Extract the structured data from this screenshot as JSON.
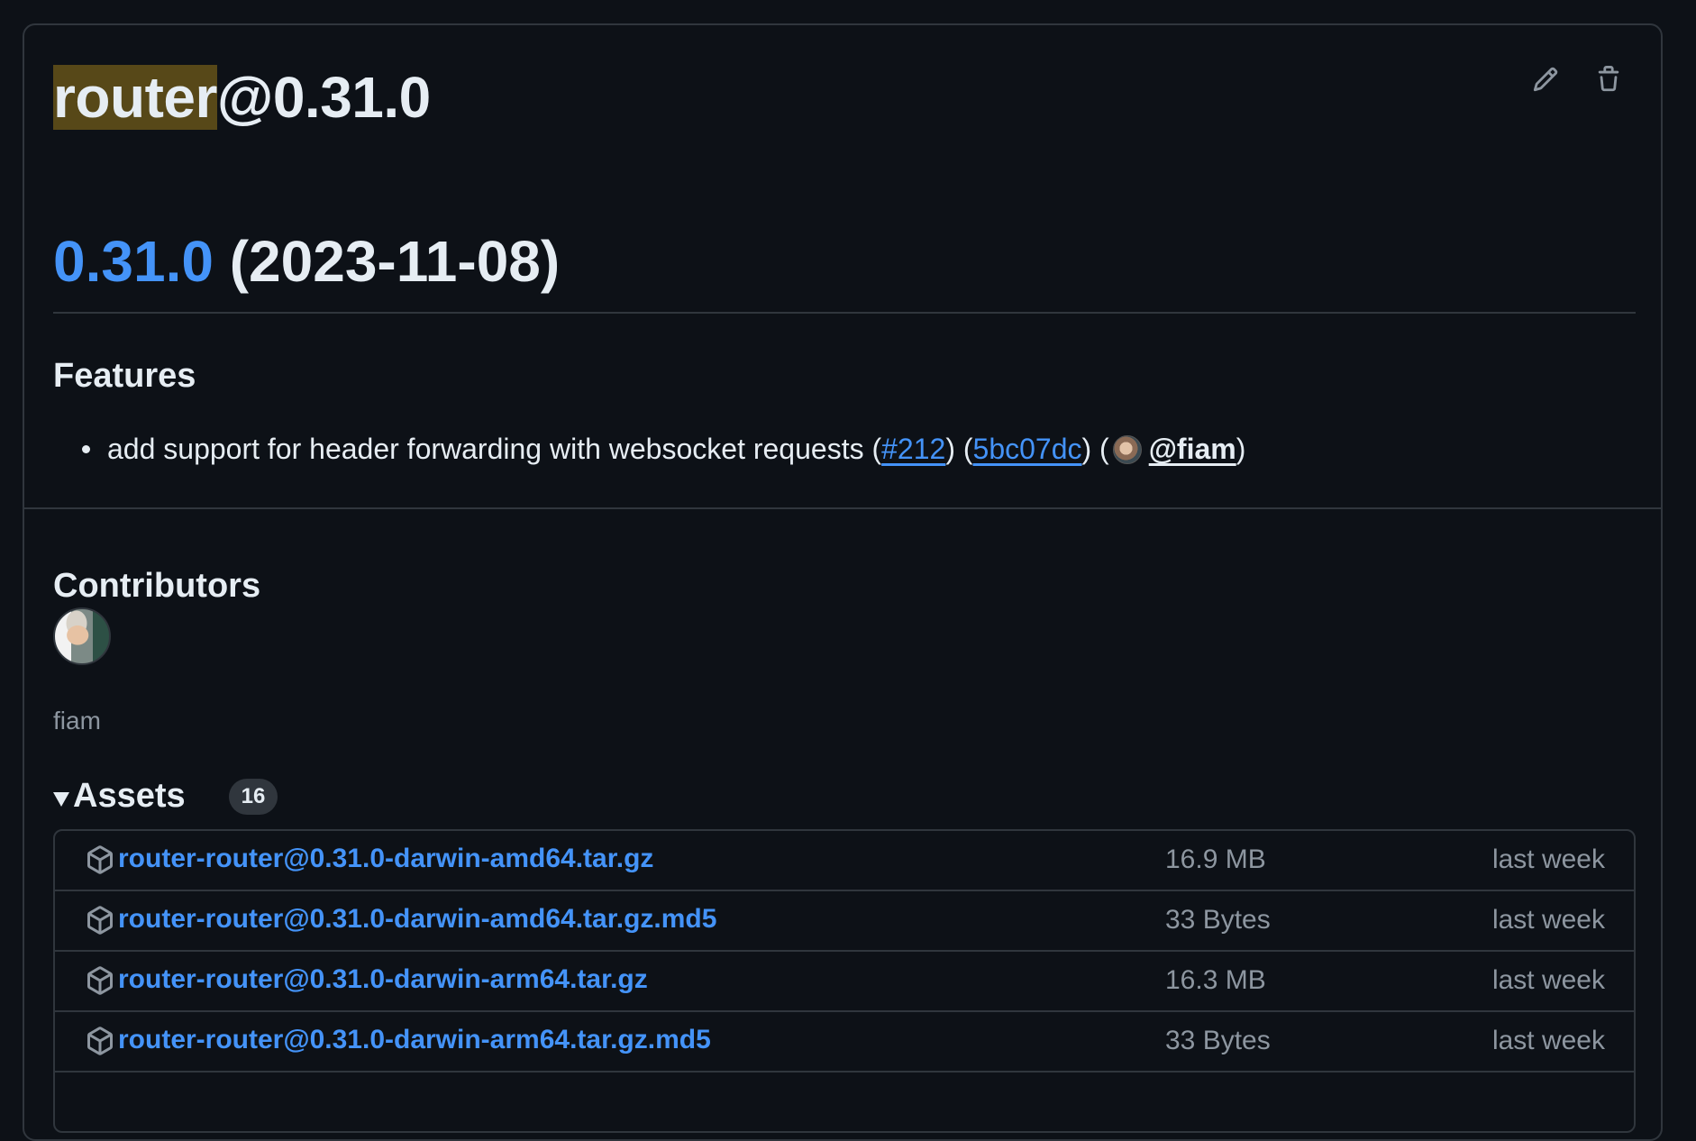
{
  "release": {
    "title_highlight": "router",
    "title_rest": "@0.31.0"
  },
  "actions": {
    "edit_icon": "pencil-icon",
    "delete_icon": "trash-icon"
  },
  "changelog": {
    "version_link": "0.31.0",
    "version_date": " (2023-11-08)",
    "features_heading": "Features",
    "feature_item": {
      "text": "add support for header forwarding with websocket requests (",
      "pr_link": "#212",
      "sep1": ") (",
      "commit_link": "5bc07dc",
      "sep2": ") (",
      "user_link": "@fiam",
      "end": ")"
    }
  },
  "contributors": {
    "heading": "Contributors",
    "name": "fiam"
  },
  "assets": {
    "label": "Assets",
    "count": "16",
    "rows": [
      {
        "name": "router-router@0.31.0-darwin-amd64.tar.gz",
        "size": "16.9 MB",
        "date": "last week"
      },
      {
        "name": "router-router@0.31.0-darwin-amd64.tar.gz.md5",
        "size": "33 Bytes",
        "date": "last week"
      },
      {
        "name": "router-router@0.31.0-darwin-arm64.tar.gz",
        "size": "16.3 MB",
        "date": "last week"
      },
      {
        "name": "router-router@0.31.0-darwin-arm64.tar.gz.md5",
        "size": "33 Bytes",
        "date": "last week"
      }
    ]
  },
  "colors": {
    "background": "#0d1117",
    "border": "#30363d",
    "link": "#4493f8",
    "highlight": "#574818",
    "muted": "#8d96a0"
  }
}
